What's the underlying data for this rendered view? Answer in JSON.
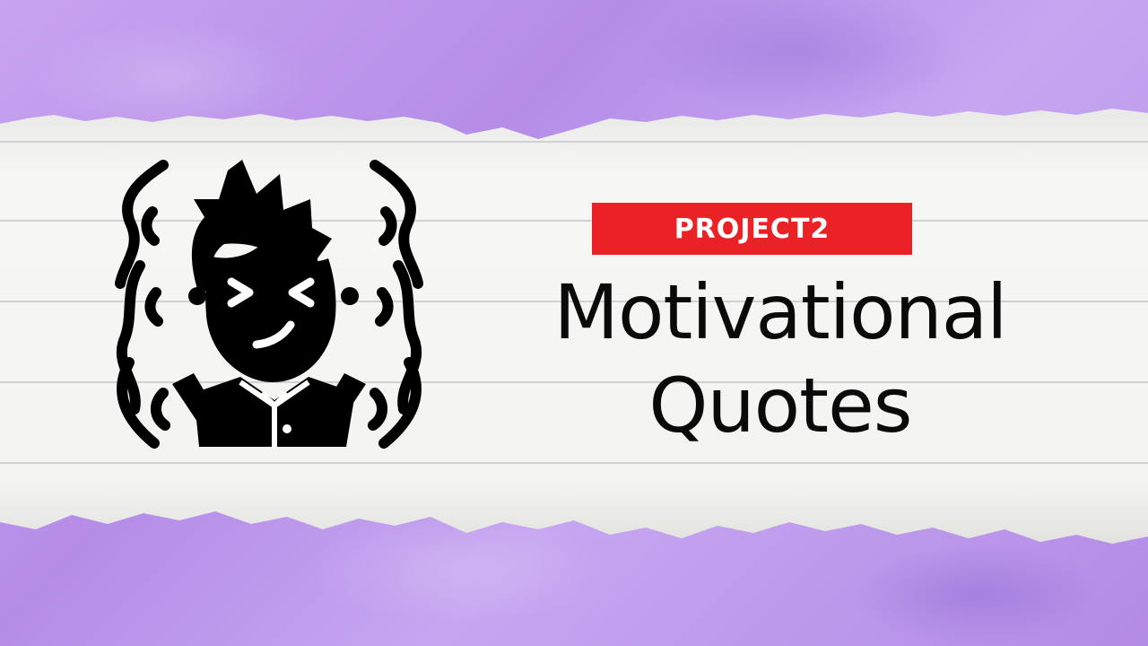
{
  "badge": {
    "label": "PROJECT2",
    "color": "#ea2226"
  },
  "title": {
    "line1": "Motivational",
    "line2": "Quotes"
  },
  "icon": {
    "name": "angry-man-icon"
  },
  "colors": {
    "background": "#b98fea",
    "paper": "#f4f4f2",
    "text": "#0a0a0a"
  }
}
